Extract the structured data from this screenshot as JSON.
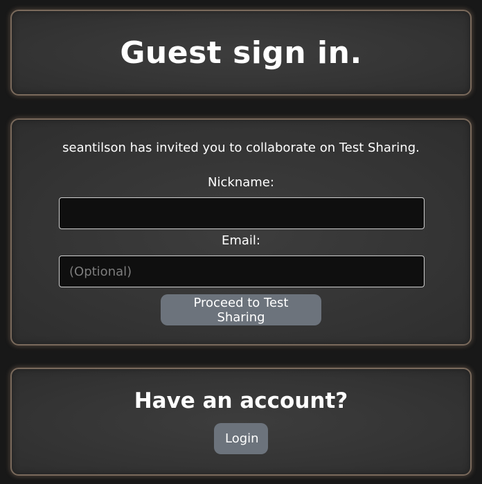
{
  "header": {
    "title": "Guest sign in."
  },
  "invite": {
    "message": "seantilson has invited you to collaborate on Test Sharing."
  },
  "form": {
    "nickname_label": "Nickname:",
    "nickname_value": "",
    "email_label": "Email:",
    "email_value": "",
    "email_placeholder": "(Optional)",
    "proceed_label": "Proceed to Test Sharing"
  },
  "account": {
    "heading": "Have an account?",
    "login_label": "Login"
  },
  "colors": {
    "page_background": "#181818",
    "card_background": "#353535",
    "card_border": "#7a6a5c",
    "input_background": "#0f0f0f",
    "button_background": "#6c737c",
    "text": "#ffffff"
  }
}
